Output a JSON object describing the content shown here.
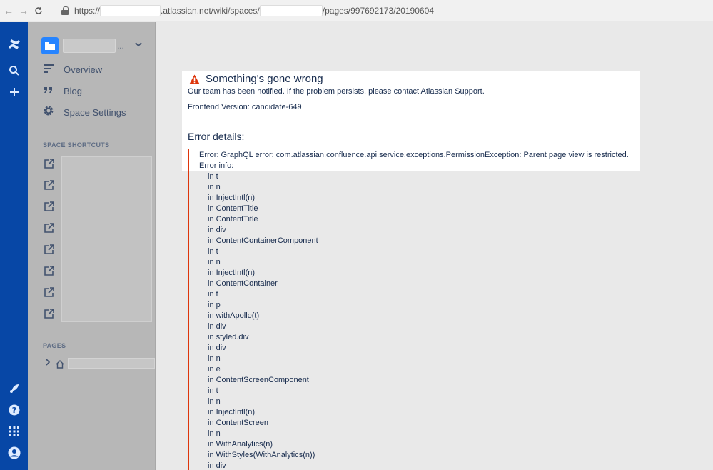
{
  "browser": {
    "url_prefix": "https://",
    "url_domain": ".atlassian.net/wiki/spaces/",
    "url_suffix": "/pages/997692173/20190604"
  },
  "global_nav": {
    "icons": [
      "confluence-logo-icon",
      "search-icon",
      "create-icon",
      "rocket-icon",
      "help-icon",
      "app-switcher-icon",
      "profile-icon"
    ]
  },
  "sidebar": {
    "space_name_ellipsis": "...",
    "items": [
      {
        "label": "Overview",
        "icon": "overview-icon"
      },
      {
        "label": "Blog",
        "icon": "blog-quote-icon"
      },
      {
        "label": "Space Settings",
        "icon": "gear-icon"
      }
    ],
    "shortcuts_label": "SPACE SHORTCUTS",
    "shortcut_count": 8,
    "pages_label": "PAGES"
  },
  "error": {
    "title": "Something's gone wrong",
    "message": "Our team has been notified. If the problem persists, please contact Atlassian Support.",
    "frontend_version": "Frontend Version: candidate-649",
    "details_heading": "Error details:",
    "error_line": "Error: GraphQL error: com.atlassian.confluence.api.service.exceptions.PermissionException: Parent page view is restricted.",
    "info_label": "Error info:",
    "stack": [
      "in t",
      "in n",
      "in InjectIntl(n)",
      "in ContentTitle",
      "in ContentTitle",
      "in div",
      "in ContentContainerComponent",
      "in t",
      "in n",
      "in InjectIntl(n)",
      "in ContentContainer",
      "in t",
      "in p",
      "in withApollo(t)",
      "in div",
      "in styled.div",
      "in div",
      "in n",
      "in e",
      "in ContentScreenComponent",
      "in t",
      "in n",
      "in InjectIntl(n)",
      "in ContentScreen",
      "in n",
      "in WithAnalytics(n)",
      "in WithStyles(WithAnalytics(n))",
      "in div"
    ]
  },
  "colors": {
    "global_nav": "#0747a6",
    "space_avatar": "#2684ff",
    "error_accent": "#de350b"
  }
}
